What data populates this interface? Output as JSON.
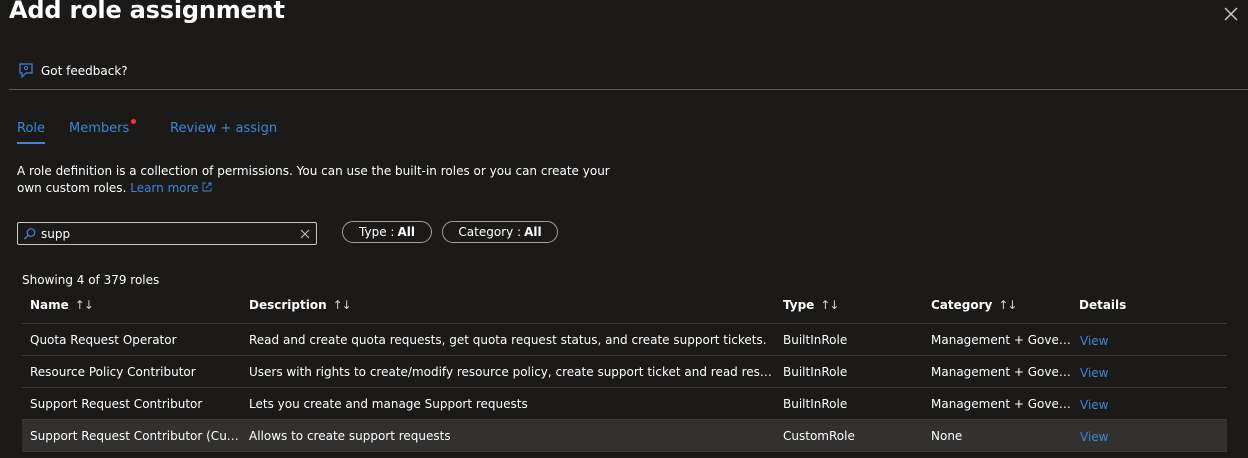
{
  "header": {
    "title": "Add role assignment",
    "more": "···"
  },
  "feedback": {
    "label": "Got feedback?"
  },
  "tabs": [
    {
      "label": "Role"
    },
    {
      "label": "Members"
    },
    {
      "label": "Review + assign"
    }
  ],
  "description": {
    "text": "A role definition is a collection of permissions. You can use the built-in roles or you can create your own custom roles.",
    "link": "Learn more"
  },
  "search": {
    "value": "supp",
    "placeholder": ""
  },
  "filters": {
    "type_label": "Type :",
    "type_value": "All",
    "category_label": "Category :",
    "category_value": "All"
  },
  "showing": "Showing 4 of 379 roles",
  "table": {
    "columns": [
      "Name",
      "Description",
      "Type",
      "Category",
      "Details"
    ],
    "rows": [
      {
        "name": "Quota Request Operator",
        "description": "Read and create quota requests, get quota request status, and create support tickets.",
        "type": "BuiltInRole",
        "category": "Management + Gover...",
        "details": "View"
      },
      {
        "name": "Resource Policy Contributor",
        "description": "Users with rights to create/modify resource policy, create support ticket and read resource...",
        "type": "BuiltInRole",
        "category": "Management + Gover...",
        "details": "View"
      },
      {
        "name": "Support Request Contributor",
        "description": "Lets you create and manage Support requests",
        "type": "BuiltInRole",
        "category": "Management + Gover...",
        "details": "View"
      },
      {
        "name": "Support Request Contributor (Cust...",
        "description": "Allows to create support requests",
        "type": "CustomRole",
        "category": "None",
        "details": "View"
      }
    ]
  },
  "colors": {
    "background": "#1b1a19",
    "accent": "#3b86d9",
    "badge": "#f1363c"
  },
  "icons": [
    "close-icon",
    "feedback-icon",
    "search-icon",
    "clear-icon",
    "external-link-icon",
    "sort-icon"
  ]
}
